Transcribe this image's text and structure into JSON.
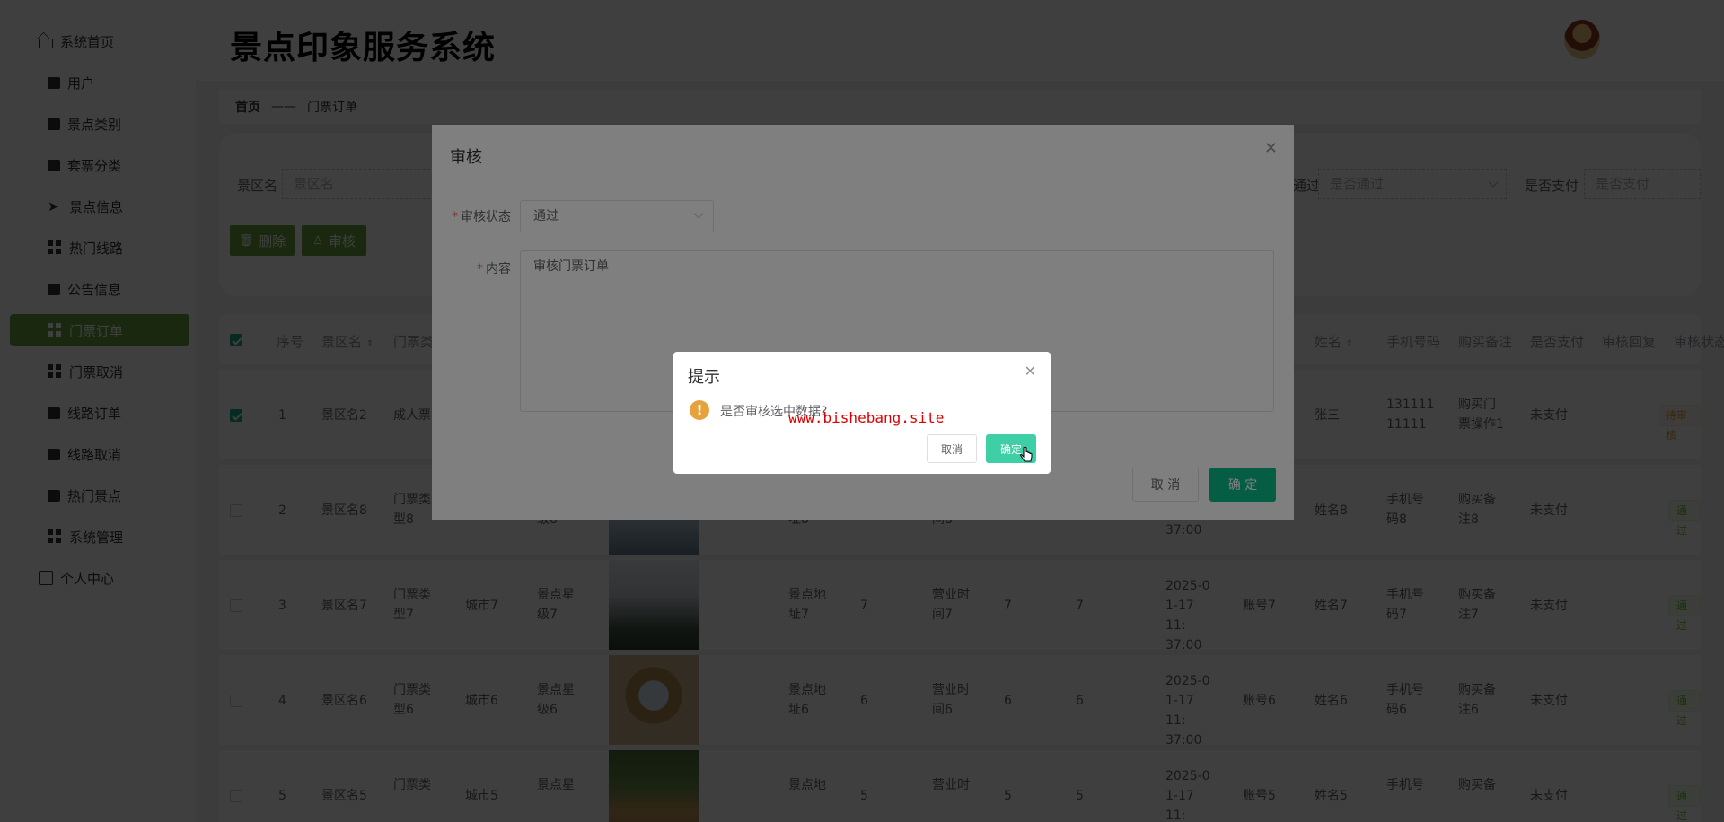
{
  "sidebar": {
    "items": [
      {
        "label": "系统首页",
        "icon": "home-icon"
      },
      {
        "label": "用户",
        "icon": "user-icon"
      },
      {
        "label": "景点类别",
        "icon": "category-icon"
      },
      {
        "label": "套票分类",
        "icon": "ticket-category-icon"
      },
      {
        "label": "景点信息",
        "icon": "send-icon"
      },
      {
        "label": "热门线路",
        "icon": "grid-icon"
      },
      {
        "label": "公告信息",
        "icon": "notice-icon"
      },
      {
        "label": "门票订单",
        "icon": "grid-icon"
      },
      {
        "label": "门票取消",
        "icon": "grid-icon"
      },
      {
        "label": "线路订单",
        "icon": "clipboard-icon"
      },
      {
        "label": "线路取消",
        "icon": "monitor-icon"
      },
      {
        "label": "热门景点",
        "icon": "printer-icon"
      },
      {
        "label": "系统管理",
        "icon": "grid-icon"
      },
      {
        "label": "个人中心",
        "icon": "profile-icon"
      }
    ],
    "active_index": 7
  },
  "header": {
    "title": "景点印象服务系统"
  },
  "breadcrumb": {
    "home": "首页",
    "separator": "——",
    "current": "门票订单"
  },
  "search": {
    "spot_name_label": "景区名",
    "spot_name_placeholder": "景区名",
    "passed_label": "通过",
    "passed_placeholder": "是否通过",
    "paid_label": "是否支付",
    "paid_placeholder": "是否支付",
    "delete_label": "删除",
    "audit_label": "审核"
  },
  "table": {
    "headers": [
      "序号",
      "景区名",
      "门票类",
      "姓名",
      "手机号码",
      "购买备注",
      "是否支付",
      "审核回复",
      "审核状态"
    ],
    "rows": [
      {
        "no": "1",
        "spot": "景区名2",
        "type": "成人票",
        "name": "张三",
        "phone": "131111 11111",
        "note": "购买门 票操作1",
        "paid": "未支付",
        "status": "待审核",
        "checked": true
      },
      {
        "no": "2",
        "spot": "景区名8",
        "type": "门票类 型8",
        "city": "",
        "level": "级8",
        "addr": "址8",
        "price": "",
        "hours": "间8",
        "qty": "",
        "total": "",
        "time": "37:00",
        "account": "",
        "name": "姓名8",
        "phone": "手机号 码8",
        "note": "购买备 注8",
        "paid": "未支付",
        "status": "通过",
        "checked": false
      },
      {
        "no": "3",
        "spot": "景区名7",
        "type": "门票类 型7",
        "city": "城市7",
        "level": "景点星 级7",
        "addr": "景点地 址7",
        "price": "7",
        "hours": "营业时 间7",
        "qty": "7",
        "total": "7",
        "time": "2025-0 1-17 11: 37:00",
        "account": "账号7",
        "name": "姓名7",
        "phone": "手机号 码7",
        "note": "购买备 注7",
        "paid": "未支付",
        "status": "通过",
        "checked": false
      },
      {
        "no": "4",
        "spot": "景区名6",
        "type": "门票类 型6",
        "city": "城市6",
        "level": "景点星 级6",
        "addr": "景点地 址6",
        "price": "6",
        "hours": "营业时 间6",
        "qty": "6",
        "total": "6",
        "time": "2025-0 1-17 11: 37:00",
        "account": "账号6",
        "name": "姓名6",
        "phone": "手机号 码6",
        "note": "购买备 注6",
        "paid": "未支付",
        "status": "通过",
        "checked": false
      },
      {
        "no": "5",
        "spot": "景区名5",
        "type": "门票类",
        "city": "城市5",
        "level": "景点星",
        "addr": "景点地",
        "price": "5",
        "hours": "营业时",
        "qty": "5",
        "total": "5",
        "time": "2025-0 1-17 11:",
        "account": "账号5",
        "name": "姓名5",
        "phone": "手机号",
        "note": "购买备",
        "paid": "未支付",
        "status": "通过",
        "checked": false
      }
    ]
  },
  "audit_dialog": {
    "title": "审核",
    "status_label": "审核状态",
    "status_value": "通过",
    "content_label": "内容",
    "content_value": "审核门票订单",
    "cancel_label": "取 消",
    "confirm_label": "确 定"
  },
  "message_box": {
    "title": "提示",
    "message": "是否审核选中数据?",
    "cancel_label": "取消",
    "confirm_label": "确定"
  },
  "watermark": "www.bishebang.site",
  "colors": {
    "active_menu": "#67a03a",
    "primary": "#0bbd87",
    "warning": "#e6a23c",
    "watermark": "#e00000"
  }
}
